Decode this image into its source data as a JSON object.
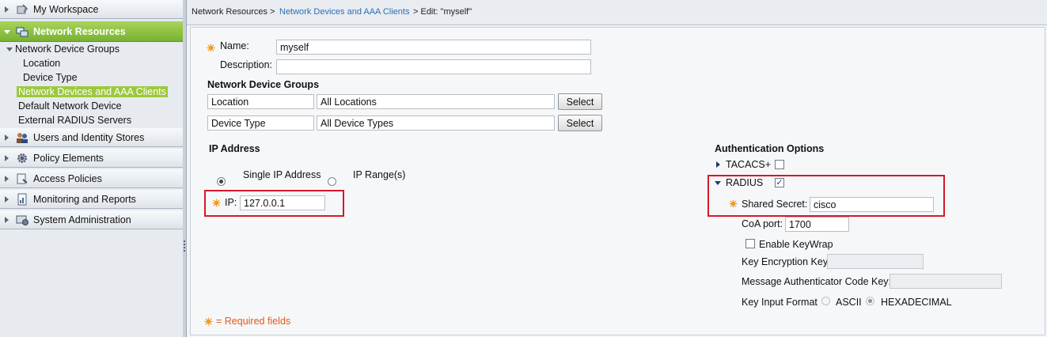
{
  "sidebar": {
    "drawers": {
      "my_workspace": {
        "label": "My Workspace",
        "icon": "workspace-icon"
      },
      "network_resources": {
        "label": "Network Resources",
        "icon": "network-icon"
      },
      "users_identity": {
        "label": "Users and Identity Stores",
        "icon": "users-icon"
      },
      "policy_elements": {
        "label": "Policy Elements",
        "icon": "policy-icon"
      },
      "access_policies": {
        "label": "Access Policies",
        "icon": "access-icon"
      },
      "monitoring": {
        "label": "Monitoring and Reports",
        "icon": "monitor-icon"
      },
      "system_admin": {
        "label": "System Administration",
        "icon": "system-icon"
      }
    },
    "tree": {
      "ndg": "Network Device Groups",
      "location": "Location",
      "device_type": "Device Type",
      "ndac": "Network Devices and AAA Clients",
      "default_device": "Default Network Device",
      "external_radius": "External RADIUS Servers"
    }
  },
  "breadcrumb": {
    "root": "Network Resources >",
    "link": "Network Devices and AAA Clients",
    "current": "> Edit: \"myself\""
  },
  "form": {
    "name_label": "Name:",
    "name_value": "myself",
    "description_label": "Description:",
    "description_value": "",
    "ndg_title": "Network Device Groups",
    "ndg_rows": [
      {
        "type": "Location",
        "value": "All Locations",
        "button": "Select"
      },
      {
        "type": "Device Type",
        "value": "All Device Types",
        "button": "Select"
      }
    ],
    "ip_title": "IP Address",
    "single_ip": "Single IP Address",
    "ip_range": "IP Range(s)",
    "ip_label": "IP:",
    "ip_value": "127.0.0.1",
    "required_note": "= Required fields"
  },
  "auth": {
    "title": "Authentication Options",
    "tacacs_label": "TACACS+",
    "tacacs_checked": false,
    "radius_label": "RADIUS",
    "radius_checked": true,
    "shared_secret_label": "Shared Secret:",
    "shared_secret_value": "cisco",
    "coa_label": "CoA port:",
    "coa_value": "1700",
    "keywrap_label": "Enable KeyWrap",
    "keywrap_checked": false,
    "key_enc_label": "Key Encryption Key:",
    "key_enc_value": "",
    "mac_key_label": "Message Authenticator Code Key:",
    "mac_key_value": "",
    "key_format_label": "Key Input Format",
    "ascii_label": "ASCII",
    "hex_label": "HEXADECIMAL",
    "key_format_selected": "HEXADECIMAL"
  },
  "colors": {
    "active_drawer": "#8cc63f",
    "selected_tree": "#9cc93c",
    "link": "#2d6fb7",
    "highlight_box": "#d6182a",
    "required_star": "#f29b1d",
    "required_text": "#e45a16"
  }
}
